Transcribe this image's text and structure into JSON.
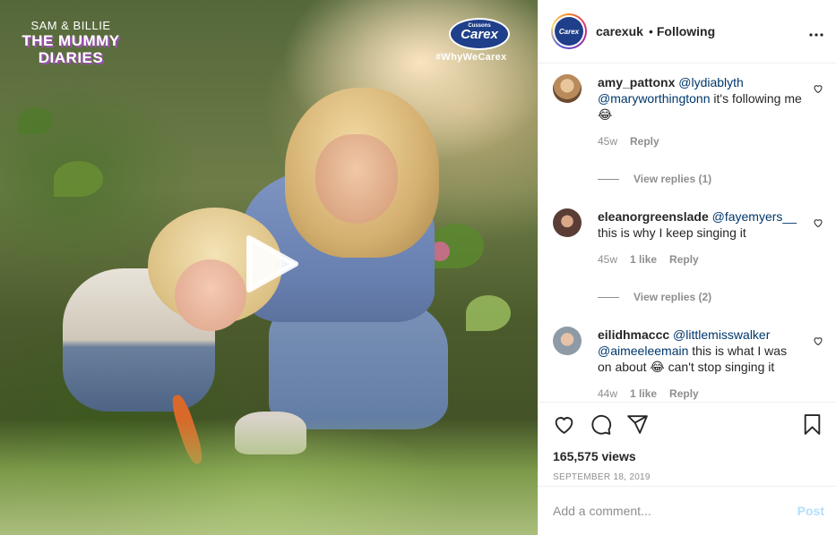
{
  "media": {
    "show_title_line1": "SAM & BILLIE",
    "show_title_line2": "THE MUMMY",
    "show_title_line3": "DIARIES",
    "brand_logo_text": "Carex",
    "brand_logo_small": "Cussons",
    "hashtag": "#WhyWeCarex",
    "play_icon": "play-icon"
  },
  "header": {
    "username": "carexuk",
    "separator": "•",
    "follow_status": "Following",
    "avatar_text": "Carex",
    "more_icon": "more-options-icon"
  },
  "comments": [
    {
      "username": "amy_pattonx",
      "mention1": "@lydiablyth",
      "mention2": "@maryworthingtonn",
      "text": " it's following me 😂",
      "age": "45w",
      "likes": "",
      "reply_label": "Reply",
      "view_replies": "View replies (1)",
      "avatar_color": "#b88a5c"
    },
    {
      "username": "eleanorgreenslade",
      "mention1": "@fayemyers__",
      "mention2": "",
      "text": "this is why I keep singing it",
      "age": "45w",
      "likes": "1 like",
      "reply_label": "Reply",
      "view_replies": "View replies (2)",
      "avatar_color": "#5a3e36"
    },
    {
      "username": "eilidhmaccc",
      "mention1": "@littlemisswalker",
      "mention2": "@aimeeleemain",
      "text": " this is what I was on about 😂 can't stop singing it",
      "age": "44w",
      "likes": "1 like",
      "reply_label": "Reply",
      "view_replies": "",
      "avatar_color": "#8e9aa6"
    }
  ],
  "actions": {
    "like_icon": "heart-icon",
    "comment_icon": "comment-icon",
    "share_icon": "share-icon",
    "save_icon": "bookmark-icon"
  },
  "stats": {
    "views": "165,575 views",
    "date": "SEPTEMBER 18, 2019"
  },
  "comment_box": {
    "placeholder": "Add a comment...",
    "post_label": "Post"
  },
  "colors": {
    "mention": "#00376b",
    "muted": "#8e8e8e",
    "post_disabled": "#b2dffc",
    "brand_blue": "#1f3f8a"
  }
}
